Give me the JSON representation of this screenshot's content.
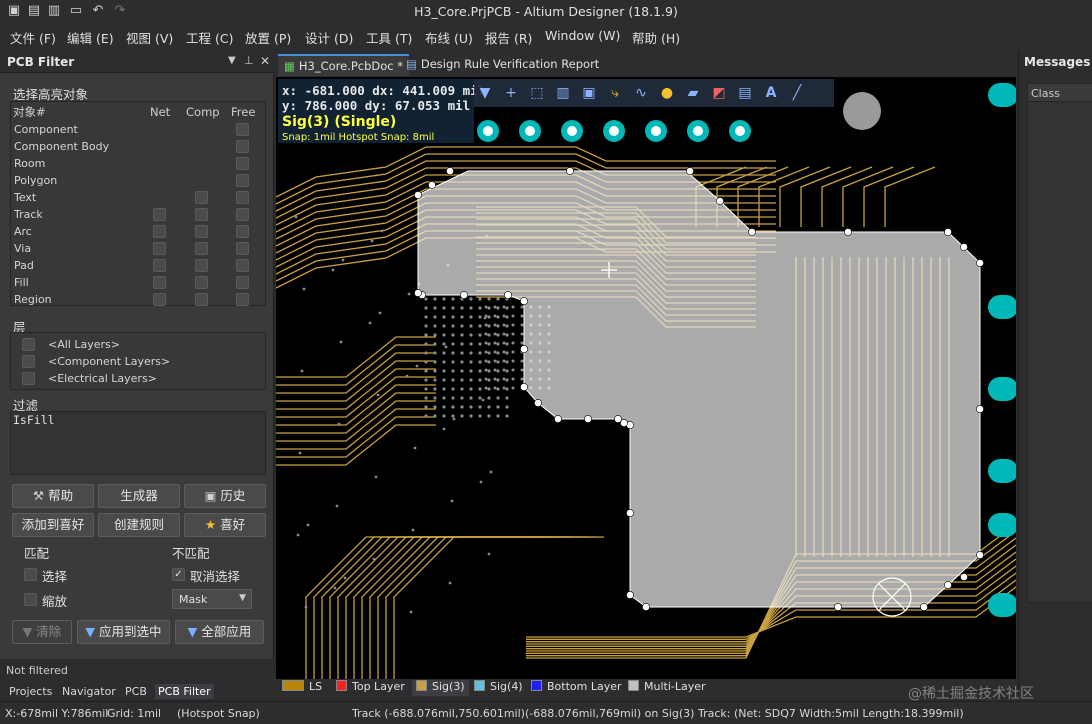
{
  "window": {
    "title": "H3_Core.PrjPCB - Altium Designer (18.1.9)"
  },
  "menu": [
    "文件 (F)",
    "编辑 (E)",
    "视图 (V)",
    "工程 (C)",
    "放置 (P)",
    "设计 (D)",
    "工具 (T)",
    "布线 (U)",
    "报告 (R)",
    "Window (W)",
    "帮助 (H)"
  ],
  "filter_panel": {
    "title": "PCB Filter",
    "highlight_section": "选择高亮对象",
    "columns": {
      "object": "对象#",
      "net": "Net",
      "comp": "Comp",
      "free": "Free"
    },
    "objects": [
      "Component",
      "Component Body",
      "Room",
      "Polygon",
      "Text",
      "Track",
      "Arc",
      "Via",
      "Pad",
      "Fill",
      "Region"
    ],
    "layers_section": "层",
    "layers": [
      "<All Layers>",
      "<Component Layers>",
      "<Electrical Layers>"
    ],
    "filter_section": "过滤",
    "filter_text": "IsFill",
    "buttons": {
      "help": "帮助",
      "generator": "生成器",
      "history": "历史",
      "add_favorite": "添加到喜好",
      "create_rule": "创建规则",
      "favorite": "喜好"
    },
    "match_label": "匹配",
    "nomatch_label": "不匹配",
    "select_label": "选择",
    "zoom_label": "缩放",
    "deselect_label": "取消选择",
    "mask_value": "Mask",
    "clear_label": "清除",
    "apply_selected_label": "应用到选中",
    "apply_all_label": "全部应用",
    "status": "Not filtered"
  },
  "left_tabs": [
    "Projects",
    "Navigator",
    "PCB",
    "PCB Filter"
  ],
  "doc_tabs": [
    "H3_Core.PcbDoc *",
    "Design Rule Verification Report"
  ],
  "hud": {
    "line1": "x:  -681.000   dx:  441.009 mil",
    "line2": "y:   786.000   dy:   67.053  mil",
    "layer": "Sig(3) (Single)",
    "snap": "Snap: 1mil Hotspot Snap: 8mil"
  },
  "layer_tabs": [
    "LS",
    "Top Layer",
    "Sig(3)",
    "Sig(4)",
    "Bottom Layer",
    "Multi-Layer"
  ],
  "layer_colors": {
    "ls": "#b8860b",
    "top": "#ff2020",
    "sig3": "#c8a040",
    "sig4": "#60c0e0",
    "bottom": "#2020ff",
    "multi": "#c0c0c0"
  },
  "right_panel": {
    "title": "Messages",
    "column": "Class"
  },
  "statusbar": {
    "coords": "X:-678mil Y:786mil",
    "grid": "Grid: 1mil",
    "snap": "(Hotspot Snap)",
    "track": "Track (-688.076mil,750.601mil)(-688.076mil,769mil) on Sig(3)",
    "net": "Track: (Net: SDQ7 Width:5mil Length:18.399mil)"
  },
  "watermark": "@稀土掘金技术社区"
}
